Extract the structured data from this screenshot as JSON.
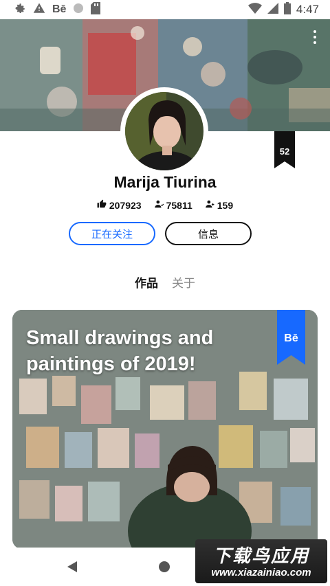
{
  "status_bar": {
    "time": "4:47",
    "left_icons": [
      "gear-icon",
      "warning-icon",
      "behance-icon",
      "circle-icon",
      "sd-card-icon"
    ],
    "behance_label": "Bē",
    "right_icons": [
      "wifi-icon",
      "signal-icon",
      "battery-icon"
    ]
  },
  "profile": {
    "name": "Marija Tiurina",
    "ranking_badge": "52",
    "stats": {
      "appreciations": "207923",
      "followers": "75811",
      "following": "159"
    },
    "follow_button": "正在关注",
    "info_button": "信息"
  },
  "tabs": [
    {
      "label": "作品",
      "active": true
    },
    {
      "label": "关于",
      "active": false
    }
  ],
  "project": {
    "title": "Small drawings and paintings of 2019!",
    "badge": "Bē"
  },
  "watermark": {
    "top": "下载鸟应用",
    "bottom": "www.xiazainiao.com"
  },
  "colors": {
    "accent": "#1769ff",
    "text": "#111111",
    "muted": "#888888"
  }
}
